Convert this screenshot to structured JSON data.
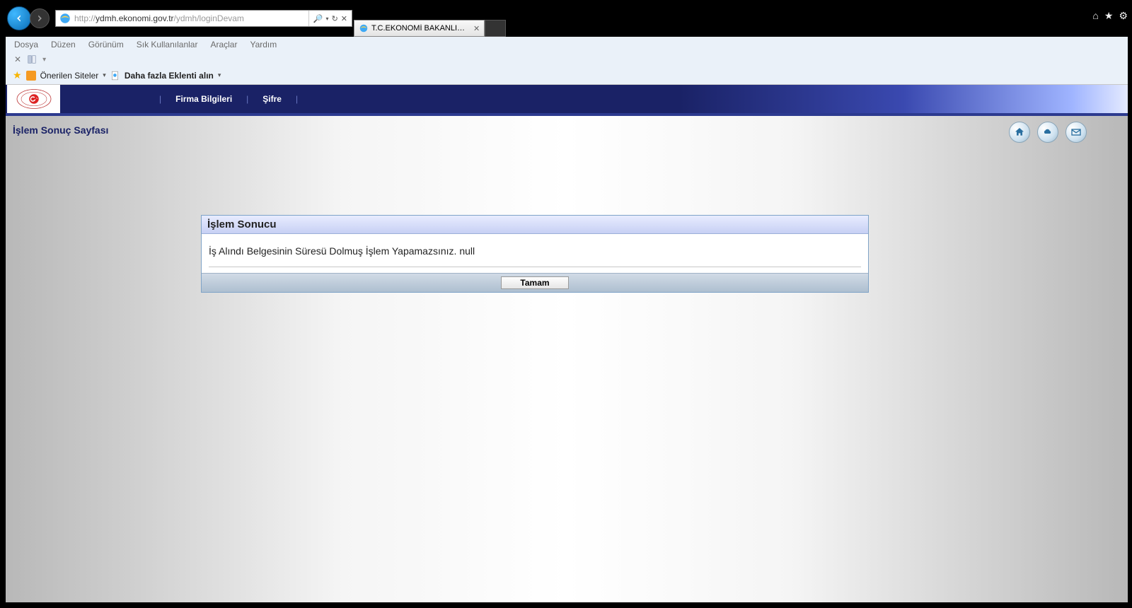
{
  "browser": {
    "url_full": "http://ydmh.ekonomi.gov.tr/ydmh/loginDevam",
    "url_host": "ydmh.ekonomi.gov.tr",
    "url_prefix": "http://",
    "url_path": "/ydmh/loginDevam",
    "search_glyph": "🔍",
    "tab_title": "T.C.EKONOMİ BAKANLIĞI -..."
  },
  "ie_menu": {
    "file": "Dosya",
    "edit": "Düzen",
    "view": "Görünüm",
    "favorites": "Sık Kullanılanlar",
    "tools": "Araçlar",
    "help": "Yardım"
  },
  "favbar": {
    "suggested": "Önerilen Siteler",
    "addons": "Daha fazla Eklenti alın"
  },
  "app_menu": {
    "firma": "Firma Bilgileri",
    "sifre": "Şifre"
  },
  "page": {
    "title": "İşlem Sonuç Sayfası"
  },
  "dialog": {
    "header": "İşlem Sonucu",
    "message": "İş Alındı Belgesinin Süresü Dolmuş İşlem Yapamazsınız. null",
    "ok": "Tamam"
  }
}
